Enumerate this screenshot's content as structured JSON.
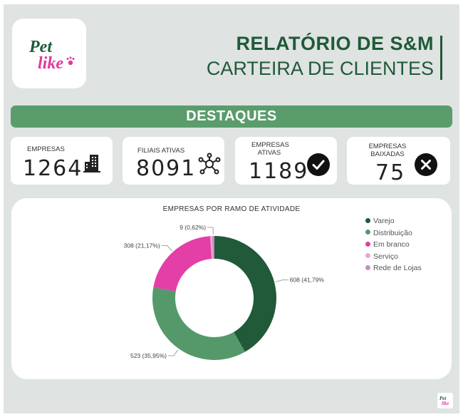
{
  "brand": {
    "logo_text_1": "Pet",
    "logo_text_2": "like"
  },
  "header": {
    "title": "RELATÓRIO DE S&M",
    "subtitle": "CARTEIRA DE CLIENTES"
  },
  "banner": {
    "label": "DESTAQUES"
  },
  "kpis": [
    {
      "label": "EMPRESAS",
      "value": "1264",
      "icon": "building-icon"
    },
    {
      "label": "FILIAIS ATIVAS",
      "value": "8091",
      "icon": "network-icon"
    },
    {
      "label_line1": "EMPRESAS",
      "label_line2": "ATIVAS",
      "value": "1189",
      "icon": "check-circle-icon"
    },
    {
      "label_line1": "EMPRESAS",
      "label_line2": "BAIXADAS",
      "value": "75",
      "icon": "x-circle-icon"
    }
  ],
  "colors": {
    "brand_green": "#1f5a38",
    "banner_green": "#5a9c6c",
    "brand_pink": "#e0399b"
  },
  "chart_data": {
    "type": "pie",
    "variant": "donut",
    "title": "EMPRESAS POR RAMO DE ATIVIDADE",
    "legend_position": "right",
    "series": [
      {
        "name": "Varejo",
        "value": 608,
        "percent": 41.79,
        "label": "608 (41,79%)",
        "color": "#215a39"
      },
      {
        "name": "Distribuição",
        "value": 523,
        "percent": 35.95,
        "label": "523 (35,95%)",
        "color": "#55996a"
      },
      {
        "name": "Em branco",
        "value": 308,
        "percent": 21.17,
        "label": "308 (21,17%)",
        "color": "#e33fa6"
      },
      {
        "name": "Serviço",
        "value": 7,
        "percent": 0.47,
        "label": "",
        "color": "#f0a3cf"
      },
      {
        "name": "Rede de Lojas",
        "value": 9,
        "percent": 0.62,
        "label": "9 (0,62%)",
        "color": "#c48fc0"
      }
    ]
  }
}
